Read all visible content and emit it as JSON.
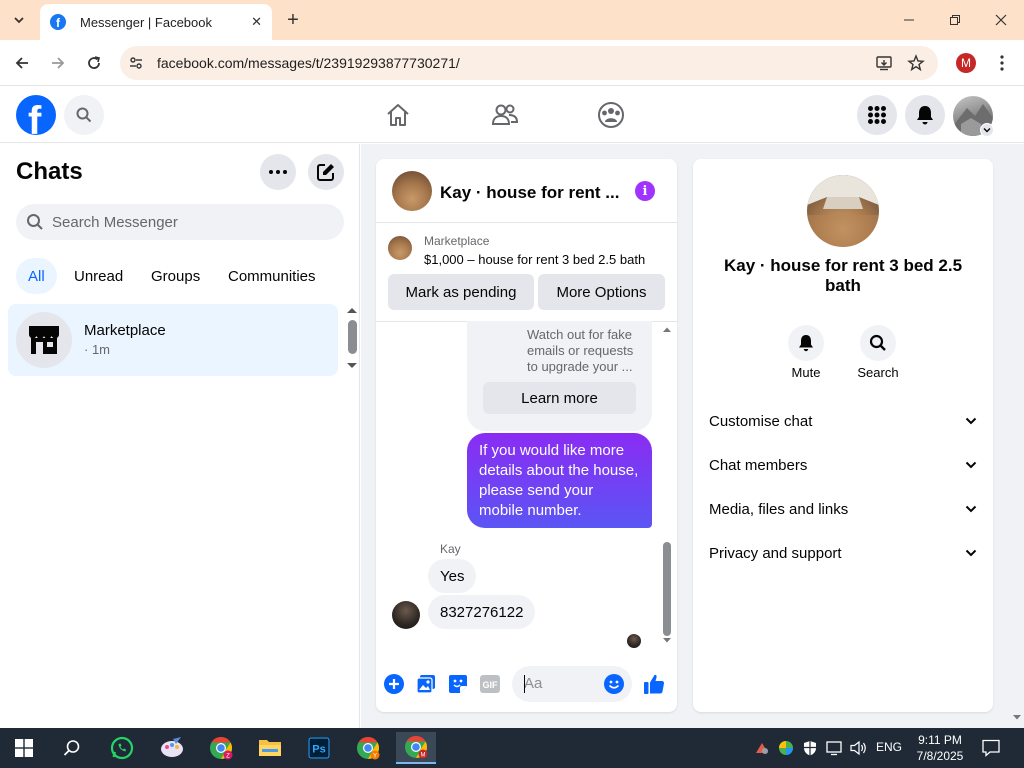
{
  "browser": {
    "tab_title": "Messenger | Facebook",
    "url": "facebook.com/messages/t/23919293877730271/",
    "profile_initial": "M"
  },
  "sidebar": {
    "title": "Chats",
    "search_placeholder": "Search Messenger",
    "filters": [
      {
        "label": "All",
        "active": true
      },
      {
        "label": "Unread",
        "active": false
      },
      {
        "label": "Groups",
        "active": false
      },
      {
        "label": "Communities",
        "active": false
      }
    ],
    "chats": [
      {
        "name": "Marketplace",
        "time": "· 1m"
      }
    ]
  },
  "conversation": {
    "title": "Kay · house for rent ...",
    "marketplace_label": "Marketplace",
    "listing": "$1,000 – house for rent 3 bed 2.5 bath",
    "mark_pending_label": "Mark as pending",
    "more_options_label": "More Options",
    "safety_text": "Watch out for fake emails or requests to upgrade your ...",
    "learn_more_label": "Learn more",
    "messages": [
      {
        "from": "me",
        "text": "If you would like more details about the house, please send your mobile number."
      },
      {
        "from": "Kay",
        "text": "Yes"
      },
      {
        "from": "Kay",
        "text": "8327276122"
      }
    ],
    "sender_name": "Kay",
    "composer_placeholder": "Aa"
  },
  "details": {
    "name": "Kay · house for rent 3 bed 2.5 bath",
    "actions": [
      {
        "label": "Mute",
        "icon": "bell-icon"
      },
      {
        "label": "Search",
        "icon": "search-icon"
      }
    ],
    "sections": [
      "Customise chat",
      "Chat members",
      "Media, files and links",
      "Privacy and support"
    ]
  },
  "taskbar": {
    "language": "ENG",
    "time": "9:11 PM",
    "date": "7/8/2025"
  },
  "colors": {
    "facebook_blue": "#0866ff",
    "messenger_gradient_top": "#8a2cf3",
    "messenger_gradient_bottom": "#5b55f4",
    "info_purple": "#a033ff",
    "tabbar_peach": "#fde1c8"
  }
}
